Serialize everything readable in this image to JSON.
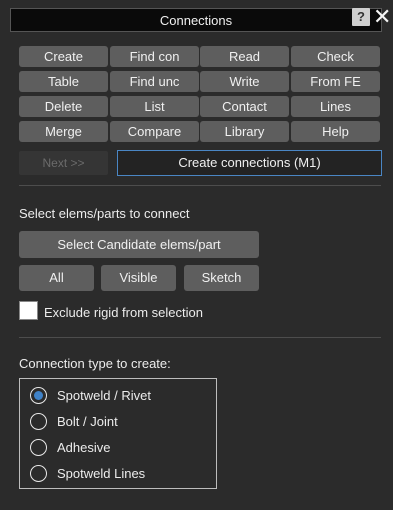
{
  "window": {
    "title": "Connections"
  },
  "titlebar": {
    "help_glyph": "?",
    "close_glyph": "✕"
  },
  "grid": [
    {
      "label": "Create",
      "state": "active"
    },
    {
      "label": "Find con",
      "state": "normal"
    },
    {
      "label": "Read",
      "state": "normal"
    },
    {
      "label": "Check",
      "state": "normal"
    },
    {
      "label": "Table",
      "state": "normal"
    },
    {
      "label": "Find unc",
      "state": "normal"
    },
    {
      "label": "Write",
      "state": "normal"
    },
    {
      "label": "From FE",
      "state": "normal"
    },
    {
      "label": "Delete",
      "state": "normal"
    },
    {
      "label": "List",
      "state": "normal"
    },
    {
      "label": "Contact",
      "state": "normal"
    },
    {
      "label": "Lines",
      "state": "normal"
    },
    {
      "label": "Merge",
      "state": "normal"
    },
    {
      "label": "Compare",
      "state": "normal"
    },
    {
      "label": "Library",
      "state": "normal"
    },
    {
      "label": "Help",
      "state": "light"
    }
  ],
  "actions": {
    "next_label": "Next >>",
    "create_label": "Create connections (M1)"
  },
  "selection": {
    "heading": "Select elems/parts to connect",
    "candidate_label": "Select Candidate elems/part",
    "all_label": "All",
    "visible_label": "Visible",
    "sketch_label": "Sketch",
    "exclude_label": "Exclude rigid from selection",
    "exclude_checked": false
  },
  "connection_type": {
    "heading": "Connection type to create:",
    "options": [
      {
        "label": "Spotweld / Rivet",
        "selected": true
      },
      {
        "label": "Bolt / Joint",
        "selected": false
      },
      {
        "label": "Adhesive",
        "selected": false
      },
      {
        "label": "Spotweld Lines",
        "selected": false
      }
    ]
  },
  "colors": {
    "accent": "#3f82c8",
    "background": "#2b2b2b",
    "button": "#5e5e5e",
    "titlebar": "#0a0a0a"
  }
}
